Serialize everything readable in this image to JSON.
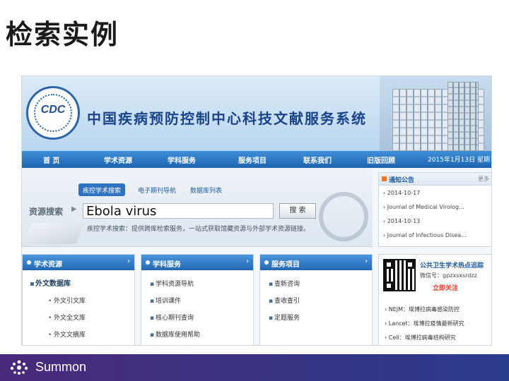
{
  "slide": {
    "title": "检索实例"
  },
  "site": {
    "name": "中国疾病预防控制中心科技文献服务系统",
    "logo_text": "CDC"
  },
  "nav": {
    "items": [
      "首 页",
      "学术资源",
      "学科服务",
      "服务项目",
      "联系我们",
      "旧版回顾"
    ],
    "date": "2015年1月13日 星期"
  },
  "search": {
    "tabs": [
      "疾控学术搜索",
      "电子期刊导航",
      "数据库列表"
    ],
    "label": "资源搜索",
    "query": "Ebola virus",
    "button": "搜 索",
    "note": "疾控学术搜索：提供跨库检索服务，一站式获取馆藏资源与外部学术资源链接。"
  },
  "notice": {
    "title": "通知公告",
    "more": "更多",
    "items": [
      "2014-10-17",
      "Journal of Medical Virolog...",
      "2014-10-13",
      "Journal of Infectious Disea..."
    ]
  },
  "columns": [
    {
      "title": "学术资源",
      "main": "外文数据库",
      "items": [
        "外文引文库",
        "外文全文库",
        "外文文摘库"
      ]
    },
    {
      "title": "学科服务",
      "items": [
        "学科资源导航",
        "培训课件",
        "核心期刊查询",
        "数据库使用帮助"
      ]
    },
    {
      "title": "服务项目",
      "items": [
        "查新咨询",
        "查收查引",
        "定题服务"
      ]
    }
  ],
  "wechat": {
    "title": "公共卫生学术热点追踪",
    "id": "微信号：gpzxsxsrdzz",
    "follow": "立即关注",
    "feeds": [
      "NEJM：埃博拉病毒感染防控",
      "Lancet：埃博拉疫情最新研究",
      "Cell：埃博拉病毒结构研究"
    ]
  },
  "footer": {
    "brand": "Summon"
  }
}
